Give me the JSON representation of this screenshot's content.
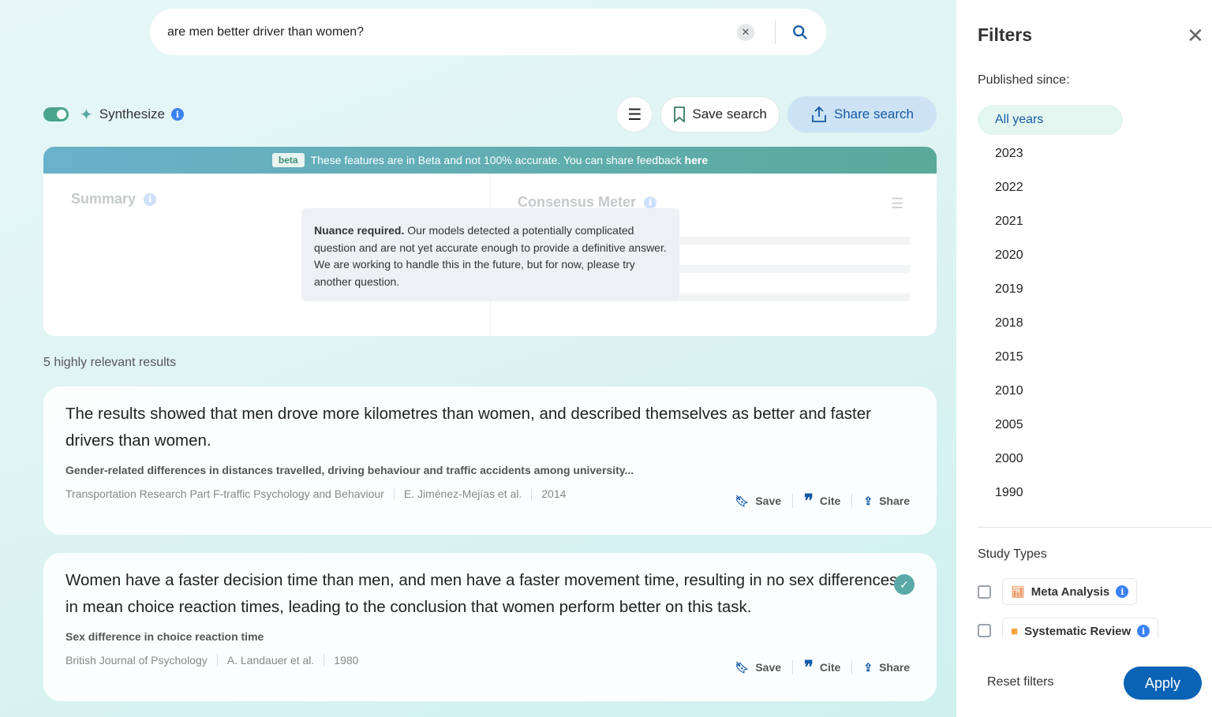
{
  "search": {
    "query": "are men better driver than women?"
  },
  "toolbar": {
    "synthesize_label": "Synthesize",
    "save_search": "Save search",
    "share_search": "Share search",
    "synthesize_on": true
  },
  "beta_banner": {
    "badge": "beta",
    "text": "These features are in Beta and not 100% accurate. You can share feedback ",
    "link": "here"
  },
  "summary": {
    "title": "Summary"
  },
  "consensus": {
    "title": "Consensus Meter"
  },
  "tooltip": {
    "bold": "Nuance required.",
    "text": " Our models detected a potentially complicated question and are not yet accurate enough to provide a definitive answer. We are working to handle this in the future, but for now, please try another question."
  },
  "results_count": "5 highly relevant results",
  "actions": {
    "save": "Save",
    "cite": "Cite",
    "share": "Share"
  },
  "results": [
    {
      "claim": "The results showed that men drove more kilometres than women, and described themselves as better and faster drivers than women.",
      "title": "Gender-related differences in distances travelled, driving behaviour and traffic accidents among university...",
      "journal": "Transportation Research Part F-traffic Psychology and Behaviour",
      "authors": "E. Jiménez-Mejías et al.",
      "year": "2014"
    },
    {
      "claim": "Women have a faster decision time than men, and men have a faster movement time, resulting in no sex differences in mean choice reaction times, leading to the conclusion that women perform better on this task.",
      "title": "Sex difference in choice reaction time",
      "journal": "British Journal of Psychology",
      "authors": "A. Landauer et al.",
      "year": "1980"
    }
  ],
  "filters": {
    "title": "Filters",
    "published_since": "Published since:",
    "years": [
      "All years",
      "2023",
      "2022",
      "2021",
      "2020",
      "2019",
      "2018",
      "2015",
      "2010",
      "2005",
      "2000",
      "1990"
    ],
    "selected_year": "All years",
    "study_types_label": "Study Types",
    "study_types": [
      "Meta Analysis",
      "Systematic Review"
    ],
    "reset": "Reset filters",
    "apply": "Apply"
  }
}
